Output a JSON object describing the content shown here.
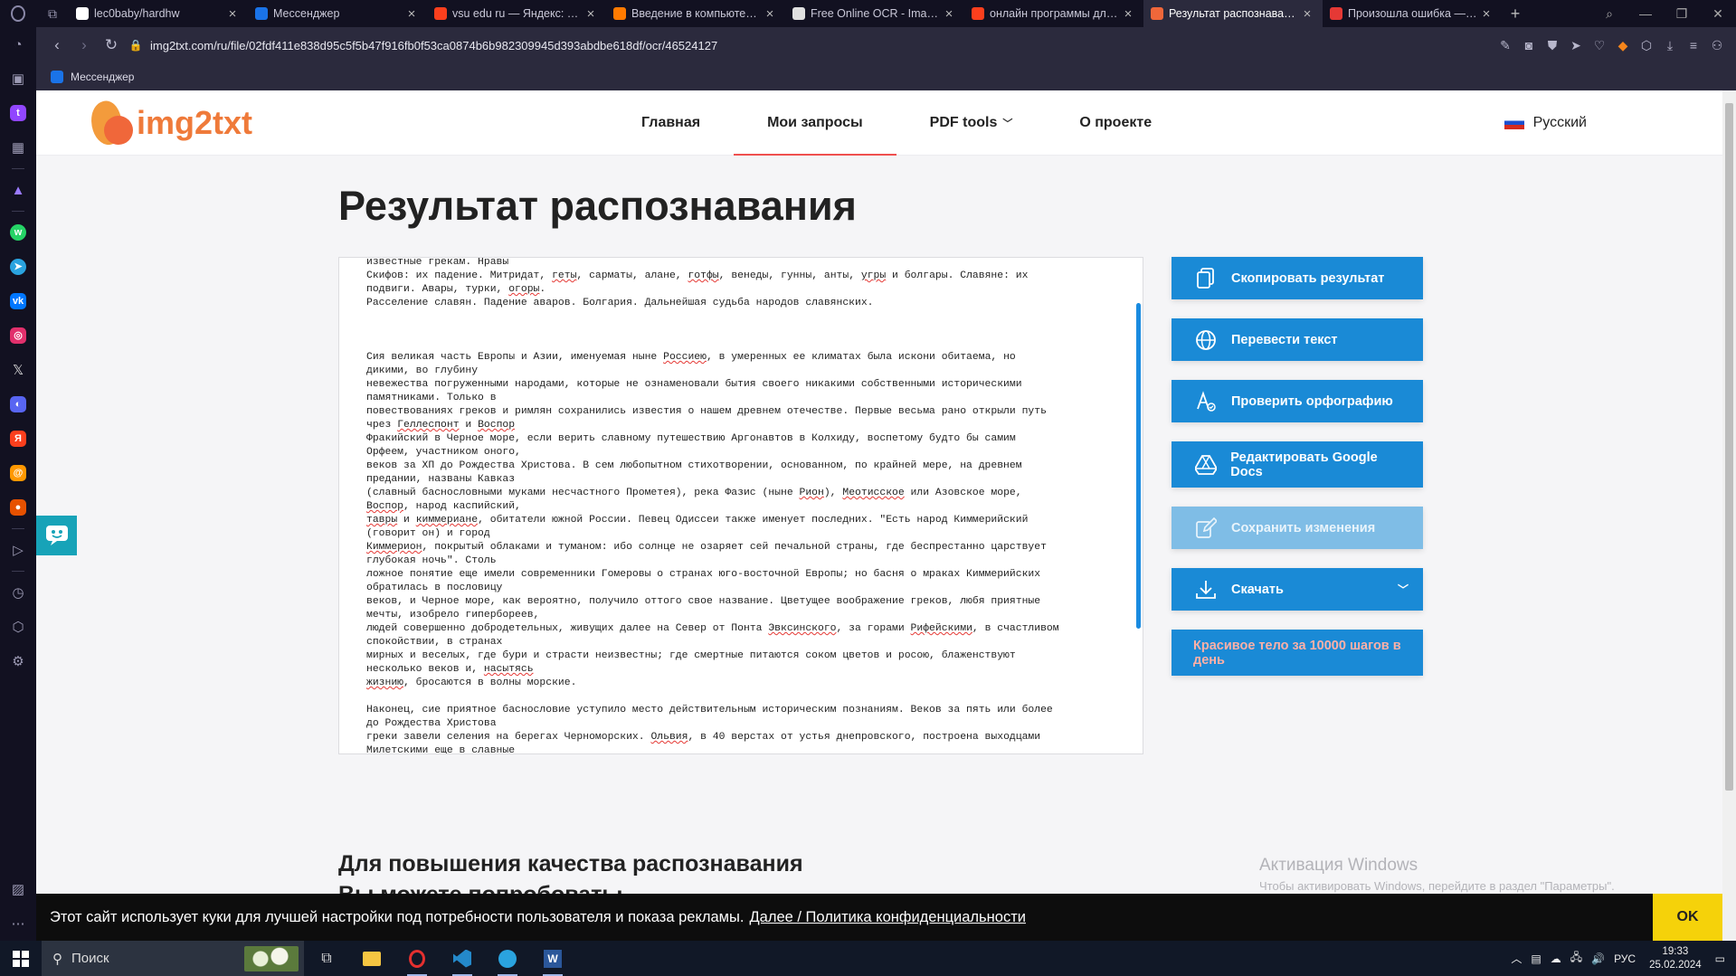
{
  "tabs": [
    {
      "title": "lec0baby/hardhw",
      "color": "#ffffff"
    },
    {
      "title": "Мессенджер",
      "color": "#1a73e8"
    },
    {
      "title": "vsu edu ru — Яндекс: нашлось",
      "color": "#fc3f1d"
    },
    {
      "title": "Введение в компьютерную",
      "color": "#ff7a00"
    },
    {
      "title": "Free Online OCR - Image to",
      "color": "#e0e0e0"
    },
    {
      "title": "онлайн программы для р",
      "color": "#fc3f1d"
    },
    {
      "title": "Результат распознавания",
      "color": "#f0673a"
    },
    {
      "title": "Произошла ошибка — Co",
      "color": "#e53935"
    }
  ],
  "address": {
    "url": "img2txt.com/ru/file/02fdf411e838d95c5f5b47f916fb0f53ca0874b6b982309945d393abdbe618df/ocr/46524127"
  },
  "bookmarks": {
    "item": "Мессенджер"
  },
  "site": {
    "logo": "img2txt",
    "nav": [
      "Главная",
      "Мои запросы",
      "PDF tools",
      "О проекте"
    ],
    "lang": "Русский"
  },
  "page": {
    "title": "Результат распознавания",
    "subheading": "Для повышения качества распознавания Вы можете попробовать:"
  },
  "ocr_text": {
    "lines": [
      "известные грекам. Нравы",
      "Скифов: их падение. Митридат, [гeты], сарматы, алане, [готфы], венеды, гунны, анты, [угры] и болгары. Славяне: их",
      "подвиги. Авары, турки, [огоры].",
      "Расселение славян. Падение аваров. Болгария. Дальнейшая судьба народов славянских.",
      "",
      "",
      "",
      "Сия великая часть Европы и Азии, именуемая ныне [Россиею], в умеренных ее климатах была искони обитаема, но",
      "дикими, во глубину",
      "невежества погруженными народами, которые не ознаменовали бытия своего никакими собственными историческими",
      "памятниками. Только в",
      "повествованиях греков и римлян сохранились известия о нашем древнем отечестве. Первые весьма рано открыли путь",
      "чрез [Геллеспонт] и [Воспор]",
      "Фракийский в Черное море, если верить славному путешествию Аргонавтов в Колхиду, воспетому будто бы самим",
      "Орфеем, участником оного,",
      "веков за ХП до Рождества Христова. В сем любопытном стихотворении, основанном, по крайней мере, на древнем",
      "предании, названы Кавказ",
      "(славный баснословными муками несчастного Прометея), река Фазис (ныне [Рион]), [Меотисское] или Азовское море,",
      "[Воспор], народ каспийский,",
      "[тавры] и [киммериане], обитатели южной России. Певец Одиссеи также именует последних. \"Есть народ Киммерийский",
      "(говорит он) и город",
      "[Киммерион], покрытый облаками и туманом: ибо солнце не озаряет сей печальной страны, где беспрестанно царствует",
      "глубокая ночь\". Столь",
      "ложное понятие еще имели современники Гомеровы о странах юго-восточной Европы; но басня о мраках Киммерийских",
      "обратилась в пословицу",
      "веков, и Черное море, как вероятно, получило оттого свое название. Цветущее воображение греков, любя приятные",
      "мечты, изобрело гипербореев,",
      "людей совершенно добродетельных, живущих далее на Север от Понта [Эвксинского], за горами [Рифейскими], в счастливом",
      "спокойствии, в странах",
      "мирных и веселых, где бури и страсти неизвестны; где смертные питаются соком цветов и росою, блаженствуют",
      "несколько веков и, [насытясь]",
      "[жизнию], бросаются в волны морские.",
      "",
      "Наконец, сие приятное баснословие уступило место действительным историческим познаниям. Веков за пять или более",
      "до Рождества Христова",
      "греки завели селения на берегах Черноморских. [Ольвия], в 40 верстах от устья днепровского, построена выходцами",
      "Милетскими еще в славные"
    ]
  },
  "actions": {
    "copy": "Скопировать результат",
    "translate": "Перевести текст",
    "spell": "Проверить орфографию",
    "gdocs": "Редактировать Google Docs",
    "save": "Сохранить изменения",
    "download": "Скачать",
    "promo": "Красивое тело за 10000 шагов в день"
  },
  "windows_watermark": {
    "title": "Активация Windows",
    "text": "Чтобы активировать Windows, перейдите в раздел \"Параметры\"."
  },
  "cookie": {
    "text": "Этот сайт использует куки для лучшей настройки под потребности пользователя и показа рекламы.",
    "link": "Далее / Политика конфиденциальности",
    "ok": "OK"
  },
  "taskbar": {
    "search": "Поиск",
    "lang": "РУС",
    "time": "19:33",
    "date": "25.02.2024"
  },
  "colors": {
    "accent": "#1a8ad6",
    "brand": "#ef7a3a",
    "cookie_ok": "#f5d20a"
  }
}
